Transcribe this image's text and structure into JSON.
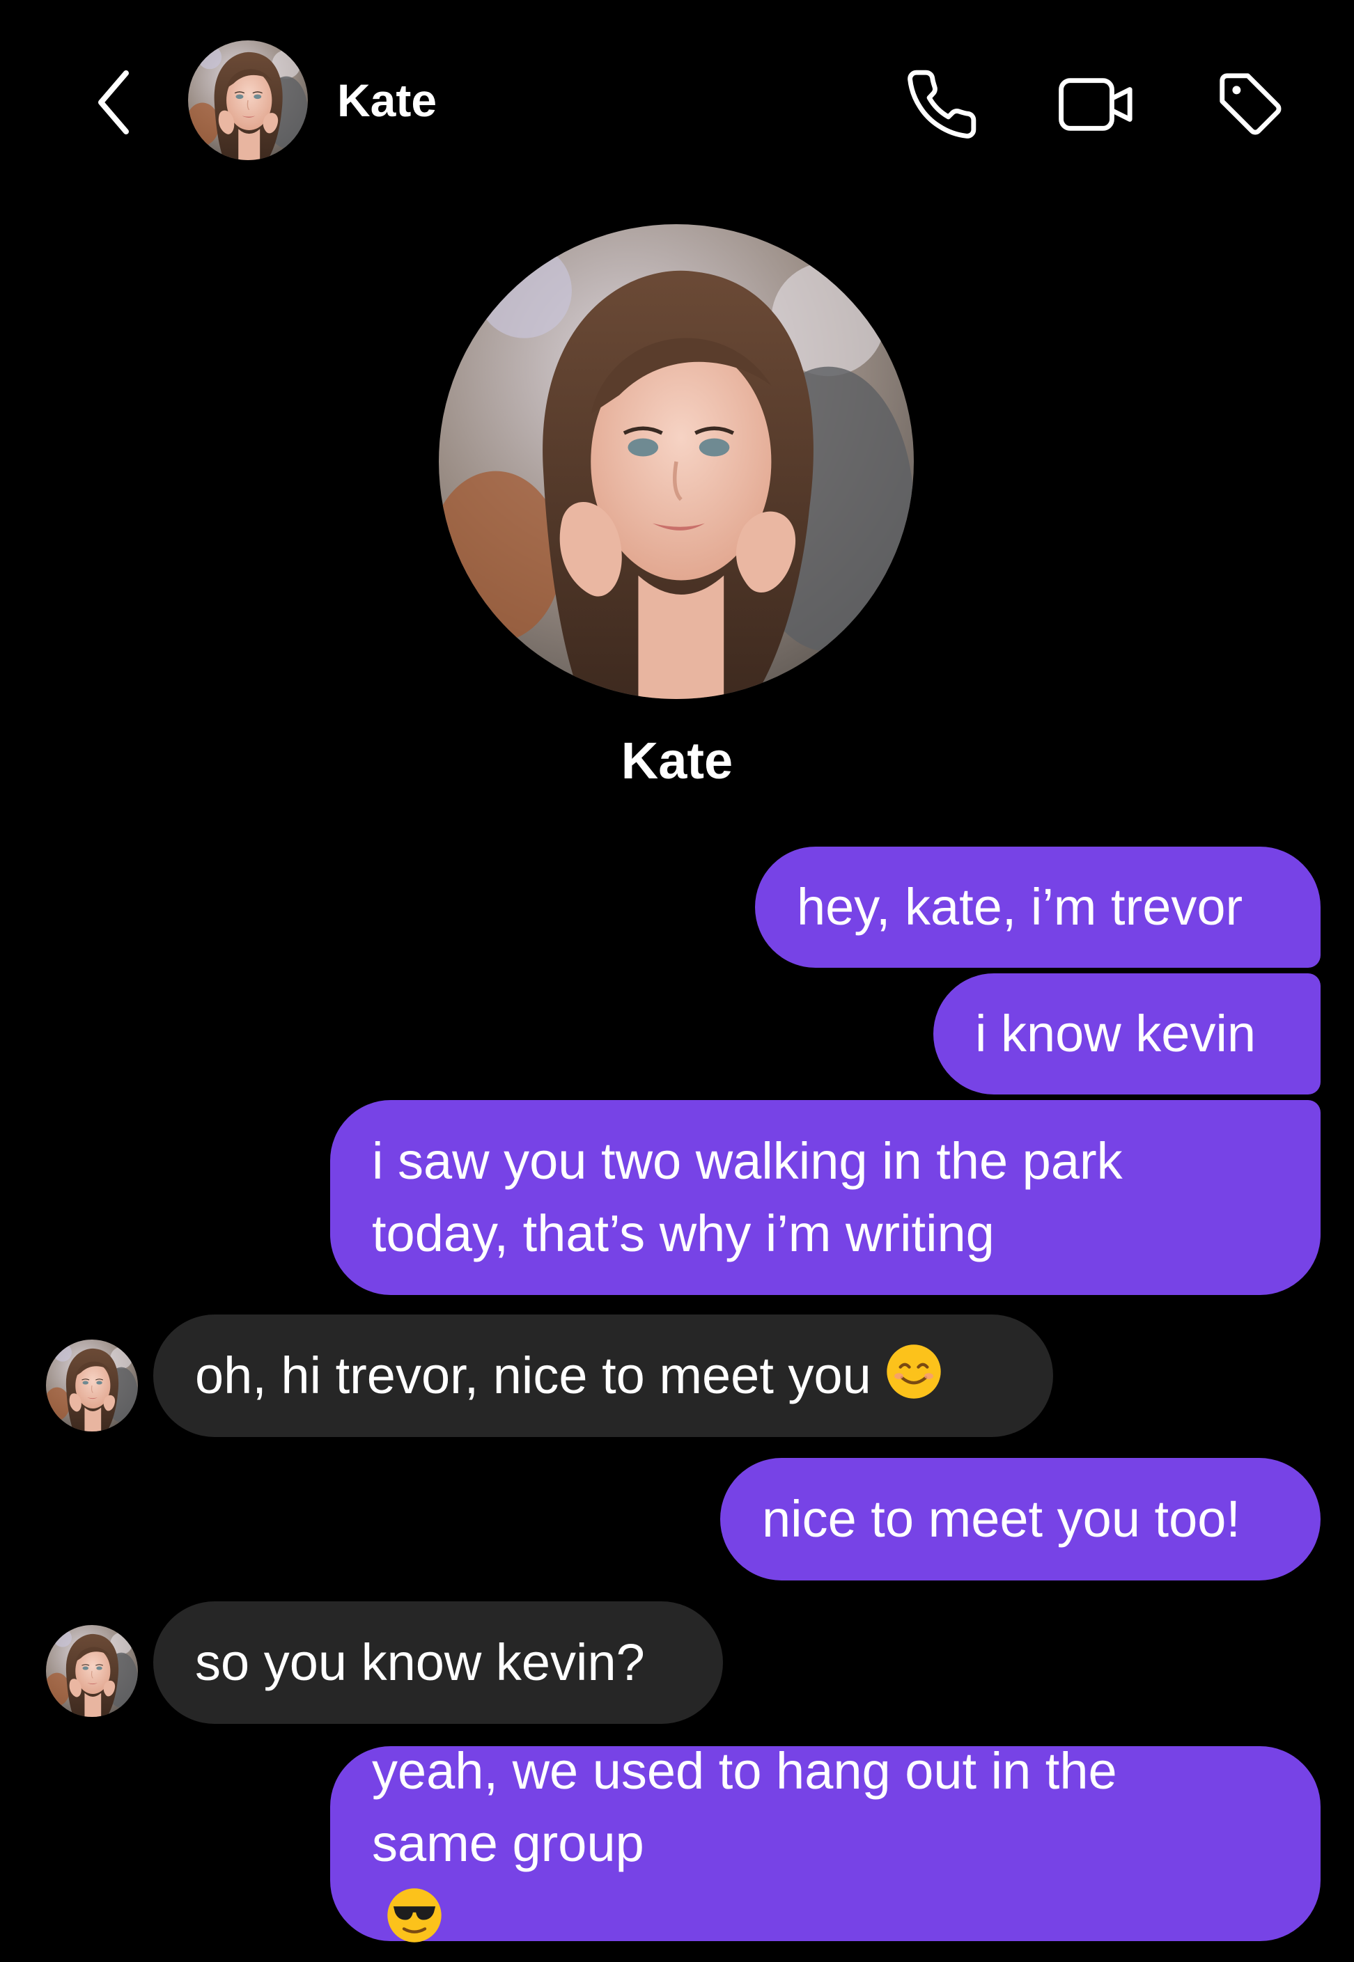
{
  "header": {
    "contact_name": "Kate",
    "icons": [
      "chevron-left-icon",
      "phone-icon",
      "video-camera-icon",
      "tag-icon"
    ]
  },
  "profile": {
    "name": "Kate"
  },
  "colors": {
    "background": "#000000",
    "outgoing_bubble": "#7743e6",
    "incoming_bubble": "#262626",
    "text": "#ffffff"
  },
  "messages": [
    {
      "direction": "outgoing",
      "lines": [
        "hey, kate, i’m trevor"
      ]
    },
    {
      "direction": "outgoing",
      "lines": [
        "i know kevin"
      ]
    },
    {
      "direction": "outgoing",
      "lines": [
        "i saw you two walking in the park",
        "today, that’s why i’m writing"
      ]
    },
    {
      "direction": "incoming",
      "lines": [
        "oh, hi trevor, nice to meet you"
      ],
      "emoji": "smiling-face-icon"
    },
    {
      "direction": "outgoing",
      "lines": [
        "nice to meet you too!"
      ]
    },
    {
      "direction": "incoming",
      "lines": [
        "so you know kevin?"
      ]
    },
    {
      "direction": "outgoing",
      "lines": [
        "yeah, we used to hang out in the",
        "same group"
      ],
      "emoji": "sunglasses-face-icon"
    }
  ]
}
